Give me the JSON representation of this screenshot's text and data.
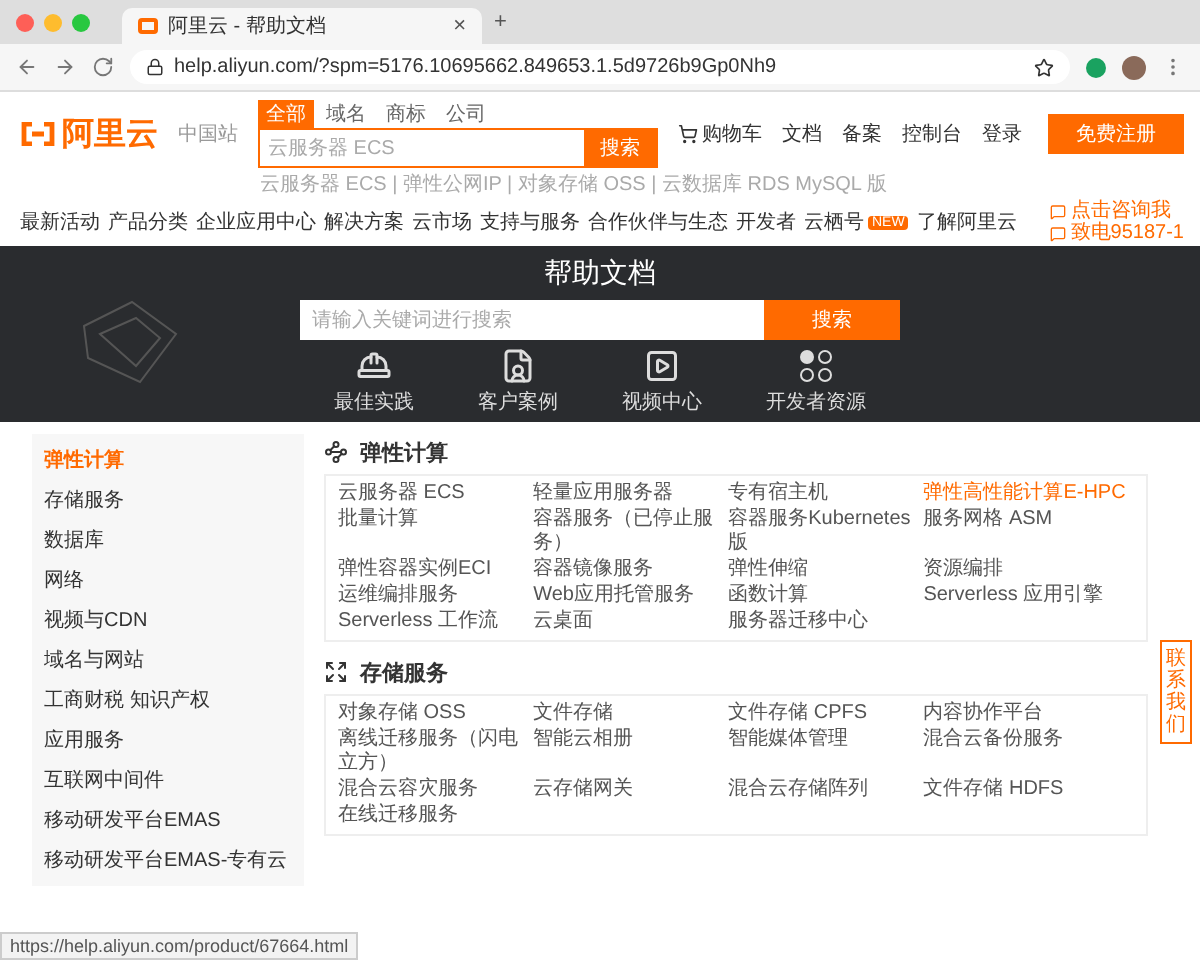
{
  "browser": {
    "tab_title": "阿里云 - 帮助文档",
    "tab_close": "×",
    "new_tab": "+",
    "url": "help.aliyun.com/?spm=5176.10695662.849653.1.5d9726b9Gp0Nh9",
    "status_url": "https://help.aliyun.com/product/67664.html"
  },
  "header": {
    "logo": "阿里云",
    "region": "中国站",
    "search_tabs": [
      {
        "label": "全部",
        "selected": true
      },
      {
        "label": "域名",
        "selected": false
      },
      {
        "label": "商标",
        "selected": false
      },
      {
        "label": "公司",
        "selected": false
      }
    ],
    "search": {
      "placeholder": "云服务器 ECS",
      "button": "搜索"
    },
    "hot_words": "云服务器 ECS | 弹性公网IP | 对象存储 OSS | 云数据库 RDS MySQL 版",
    "links": [
      "购物车",
      "文档",
      "备案",
      "控制台",
      "登录"
    ],
    "register": "免费注册",
    "nav": [
      {
        "label": "最新活动"
      },
      {
        "label": "产品分类"
      },
      {
        "label": "企业应用中心"
      },
      {
        "label": "解决方案"
      },
      {
        "label": "云市场"
      },
      {
        "label": "支持与服务"
      },
      {
        "label": "合作伙伴与生态"
      },
      {
        "label": "开发者"
      },
      {
        "label": "云栖号",
        "badge": "NEW"
      },
      {
        "label": "了解阿里云"
      }
    ],
    "contact": [
      "点击咨询我",
      "致电95187-1"
    ]
  },
  "banner": {
    "title": "帮助文档",
    "search_placeholder": "请输入关键词进行搜索",
    "search_button": "搜索",
    "shortcuts": [
      {
        "kind": "practice",
        "label": "最佳实践"
      },
      {
        "kind": "cases",
        "label": "客户案例"
      },
      {
        "kind": "video",
        "label": "视频中心"
      },
      {
        "kind": "developer",
        "label": "开发者资源"
      }
    ]
  },
  "sidebar": {
    "items": [
      {
        "label": "弹性计算",
        "selected": true
      },
      {
        "label": "存储服务",
        "selected": false
      },
      {
        "label": "数据库",
        "selected": false
      },
      {
        "label": "网络",
        "selected": false
      },
      {
        "label": "视频与CDN",
        "selected": false
      },
      {
        "label": "域名与网站",
        "selected": false
      },
      {
        "label": "工商财税 知识产权",
        "selected": false
      },
      {
        "label": "应用服务",
        "selected": false
      },
      {
        "label": "互联网中间件",
        "selected": false
      },
      {
        "label": "移动研发平台EMAS",
        "selected": false
      },
      {
        "label": "移动研发平台EMAS-专有云",
        "selected": false
      }
    ]
  },
  "sections": [
    {
      "kind": "compute",
      "title": "弹性计算",
      "items": [
        {
          "label": "云服务器 ECS",
          "hot": false
        },
        {
          "label": "轻量应用服务器",
          "hot": false
        },
        {
          "label": "专有宿主机",
          "hot": false
        },
        {
          "label": "弹性高性能计算E-HPC",
          "hot": true
        },
        {
          "label": "批量计算",
          "hot": false
        },
        {
          "label": "容器服务（已停止服务）",
          "hot": false
        },
        {
          "label": "容器服务Kubernetes版",
          "hot": false
        },
        {
          "label": "服务网格 ASM",
          "hot": false
        },
        {
          "label": "弹性容器实例ECI",
          "hot": false
        },
        {
          "label": "容器镜像服务",
          "hot": false
        },
        {
          "label": "弹性伸缩",
          "hot": false
        },
        {
          "label": "资源编排",
          "hot": false
        },
        {
          "label": "运维编排服务",
          "hot": false
        },
        {
          "label": "Web应用托管服务",
          "hot": false
        },
        {
          "label": "函数计算",
          "hot": false
        },
        {
          "label": "Serverless 应用引擎",
          "hot": false
        },
        {
          "label": "Serverless 工作流",
          "hot": false
        },
        {
          "label": "云桌面",
          "hot": false
        },
        {
          "label": "服务器迁移中心",
          "hot": false
        }
      ]
    },
    {
      "kind": "storage",
      "title": "存储服务",
      "items": [
        {
          "label": "对象存储 OSS",
          "hot": false
        },
        {
          "label": "文件存储",
          "hot": false
        },
        {
          "label": "文件存储 CPFS",
          "hot": false
        },
        {
          "label": "内容协作平台",
          "hot": false
        },
        {
          "label": "离线迁移服务（闪电立方）",
          "hot": false
        },
        {
          "label": "智能云相册",
          "hot": false
        },
        {
          "label": "智能媒体管理",
          "hot": false
        },
        {
          "label": "混合云备份服务",
          "hot": false
        },
        {
          "label": "混合云容灾服务",
          "hot": false
        },
        {
          "label": "云存储网关",
          "hot": false
        },
        {
          "label": "混合云存储阵列",
          "hot": false
        },
        {
          "label": "文件存储 HDFS",
          "hot": false
        },
        {
          "label": "在线迁移服务",
          "hot": false
        }
      ]
    }
  ],
  "float_tab": "联系我们"
}
